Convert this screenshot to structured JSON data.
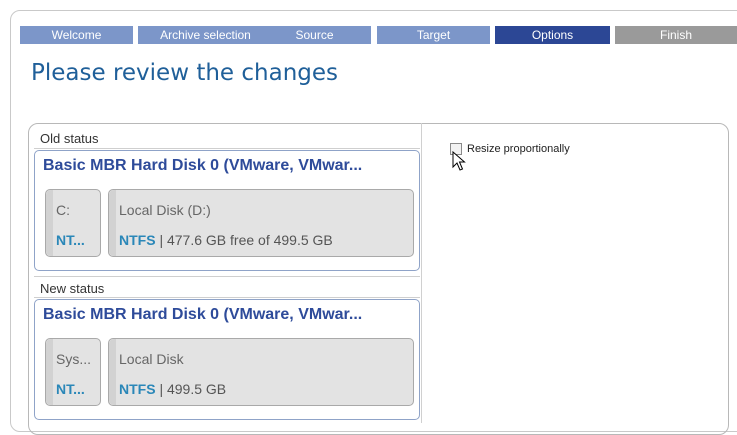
{
  "wizard": {
    "steps": [
      {
        "label": "Welcome",
        "state": "done"
      },
      {
        "label": "Archive selection",
        "state": "done"
      },
      {
        "label": "Source",
        "state": "done"
      },
      {
        "label": "Target",
        "state": "done"
      },
      {
        "label": "Options",
        "state": "active"
      },
      {
        "label": "Finish",
        "state": "pending"
      }
    ]
  },
  "page": {
    "title": "Please review the changes"
  },
  "old_status": {
    "label": "Old status",
    "disk_title": "Basic MBR Hard Disk 0 (VMware, VMwar...",
    "partitions": [
      {
        "name": "C:",
        "fs": "NT...",
        "info": ""
      },
      {
        "name": "Local Disk (D:)",
        "fs": "NTFS",
        "info": " | 477.6 GB free of 499.5 GB"
      }
    ]
  },
  "new_status": {
    "label": "New status",
    "disk_title": "Basic MBR Hard Disk 0 (VMware, VMwar...",
    "partitions": [
      {
        "name": "Sys...",
        "fs": "NT...",
        "info": ""
      },
      {
        "name": "Local Disk",
        "fs": "NTFS",
        "info": " | 499.5 GB"
      }
    ]
  },
  "options": {
    "resize_label": "Resize proportionally",
    "resize_checked": false
  },
  "colors": {
    "step_done": "#7c96c9",
    "step_active": "#2c4795",
    "step_pending": "#9a9a9a",
    "title": "#1f5f99",
    "disk_title": "#2e4b9a",
    "fs_label": "#2a87b8"
  }
}
